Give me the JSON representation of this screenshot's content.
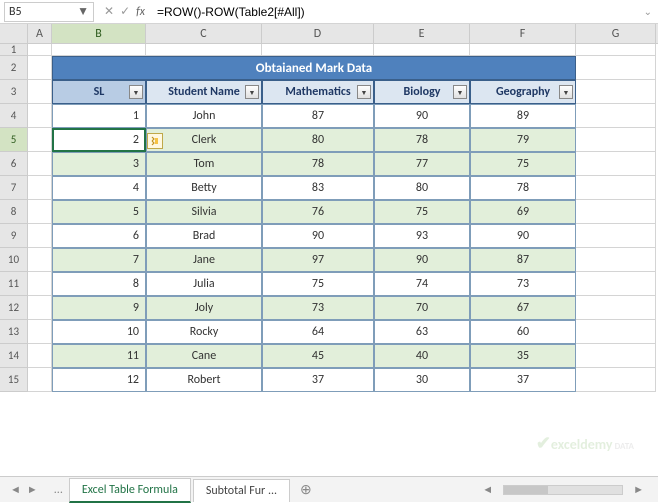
{
  "name_box": "B5",
  "formula": "=ROW()-ROW(Table2[#All])",
  "columns": [
    "A",
    "B",
    "C",
    "D",
    "E",
    "F",
    "G"
  ],
  "active_col": "B",
  "active_row": 5,
  "title": "Obtaianed Mark Data",
  "headers": {
    "sl": "SL",
    "name": "Student Name",
    "math": "Mathematics",
    "bio": "Biology",
    "geo": "Geography"
  },
  "rows": [
    {
      "r": 4,
      "sl": "1",
      "name": "John",
      "math": "87",
      "bio": "90",
      "geo": "89",
      "band": false
    },
    {
      "r": 5,
      "sl": "2",
      "name": "Clerk",
      "math": "80",
      "bio": "78",
      "geo": "79",
      "band": true,
      "selected": true,
      "badge": true
    },
    {
      "r": 6,
      "sl": "3",
      "name": "Tom",
      "math": "78",
      "bio": "77",
      "geo": "75",
      "band": true
    },
    {
      "r": 7,
      "sl": "4",
      "name": "Betty",
      "math": "83",
      "bio": "80",
      "geo": "78",
      "band": false
    },
    {
      "r": 8,
      "sl": "5",
      "name": "Silvia",
      "math": "76",
      "bio": "75",
      "geo": "69",
      "band": true
    },
    {
      "r": 9,
      "sl": "6",
      "name": "Brad",
      "math": "90",
      "bio": "93",
      "geo": "90",
      "band": false
    },
    {
      "r": 10,
      "sl": "7",
      "name": "Jane",
      "math": "97",
      "bio": "90",
      "geo": "87",
      "band": true
    },
    {
      "r": 11,
      "sl": "8",
      "name": "Julia",
      "math": "75",
      "bio": "74",
      "geo": "73",
      "band": false
    },
    {
      "r": 12,
      "sl": "9",
      "name": "Joly",
      "math": "73",
      "bio": "70",
      "geo": "67",
      "band": true
    },
    {
      "r": 13,
      "sl": "10",
      "name": "Rocky",
      "math": "64",
      "bio": "63",
      "geo": "60",
      "band": false
    },
    {
      "r": 14,
      "sl": "11",
      "name": "Cane",
      "math": "45",
      "bio": "40",
      "geo": "35",
      "band": true
    },
    {
      "r": 15,
      "sl": "12",
      "name": "Robert",
      "math": "37",
      "bio": "30",
      "geo": "37",
      "band": false
    }
  ],
  "tabs": {
    "active": "Excel Table Formula",
    "others": [
      "Subtotal Fur"
    ],
    "dots": "..."
  },
  "watermark": "exceldemy"
}
